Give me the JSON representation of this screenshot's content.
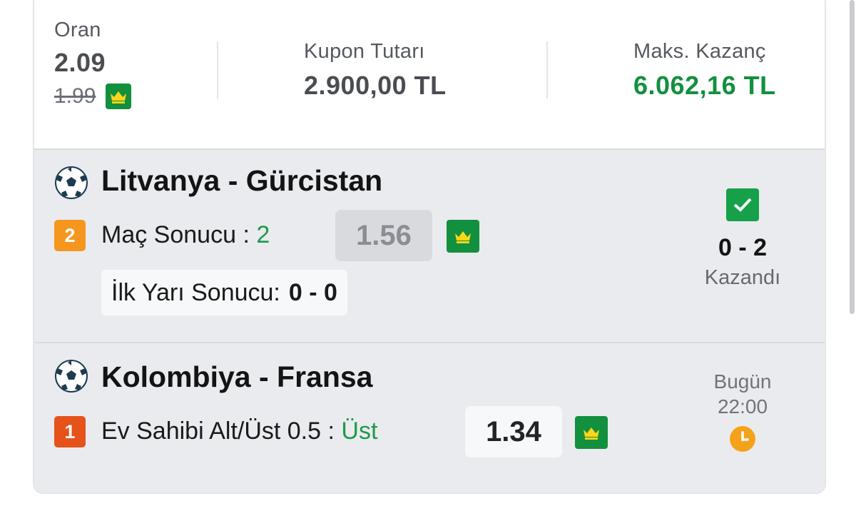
{
  "summary": {
    "odds_label": "Oran",
    "odds_value": "2.09",
    "odds_old": "1.99",
    "stake_label": "Kupon Tutarı",
    "stake_value": "2.900,00 TL",
    "max_win_label": "Maks. Kazanç",
    "max_win_value": "6.062,16 TL"
  },
  "matches": [
    {
      "teams": "Litvanya - Gürcistan",
      "mbs": "2",
      "market_label": "Maç Sonucu :",
      "pick": "2",
      "odd": "1.56",
      "extra_label": "İlk Yarı Sonucu:",
      "extra_value": "0 - 0",
      "score": "0 - 2",
      "status": "Kazandı"
    },
    {
      "teams": "Kolombiya - Fransa",
      "mbs": "1",
      "market_label": "Ev Sahibi Alt/Üst 0.5 :",
      "pick": "Üst",
      "odd": "1.34",
      "day": "Bugün",
      "time": "22:00"
    }
  ],
  "colors": {
    "win_green": "#12903e",
    "pick_green": "#1d9a4c",
    "crown_yellow": "#ffd51a",
    "mbs2_orange": "#f5961f",
    "mbs1_red": "#e5521a",
    "clock_orange": "#f5a21b"
  },
  "icons": [
    "soccer-ball-icon",
    "crown-icon",
    "check-icon",
    "clock-icon"
  ]
}
